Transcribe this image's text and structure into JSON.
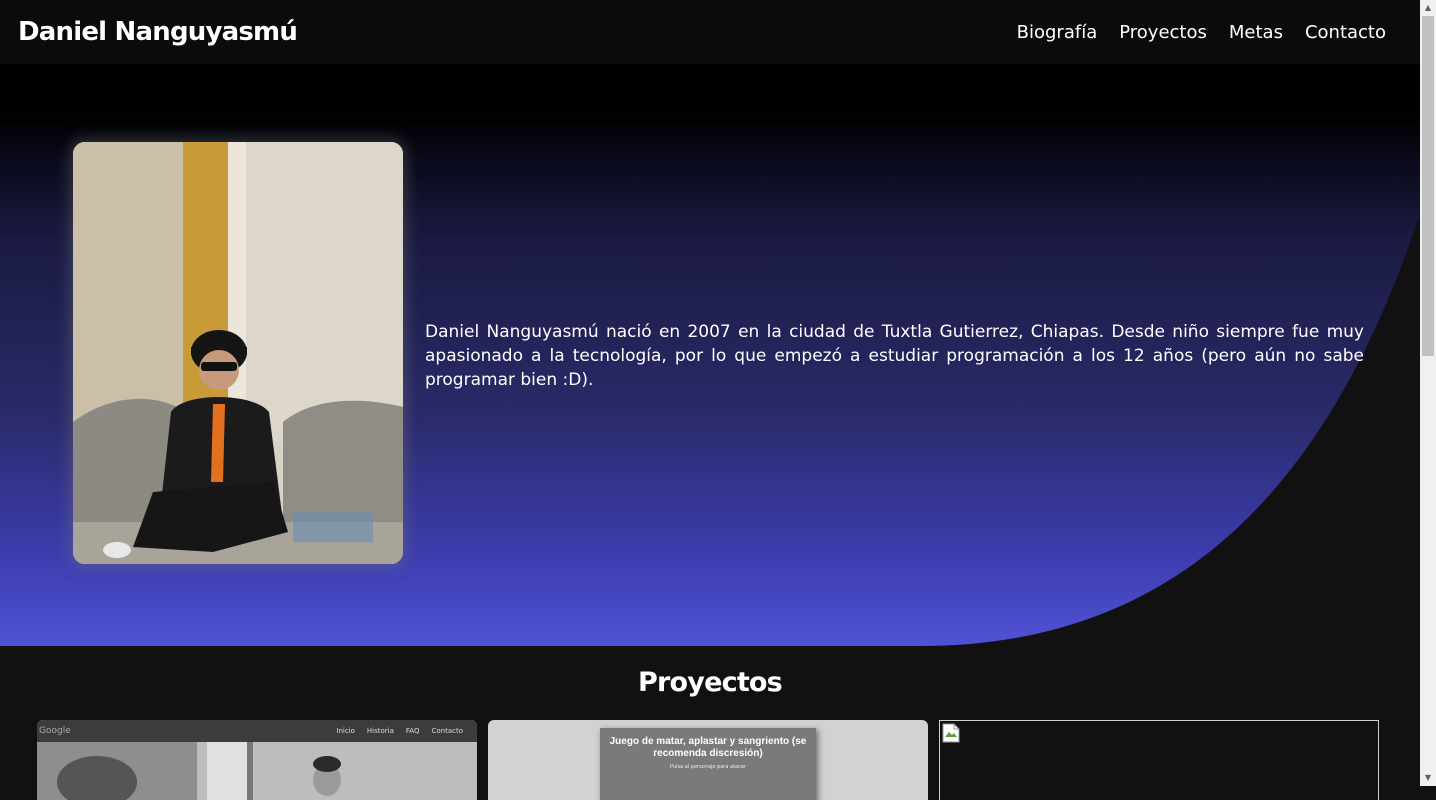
{
  "brand": "Daniel Nanguyasmú",
  "nav": [
    "Biografía",
    "Proyectos",
    "Metas",
    "Contacto"
  ],
  "bio": "Daniel Nanguyasmú nació en 2007 en la ciudad de Tuxtla Gutierrez, Chiapas. Desde niño siempre fue muy apasionado a la tecnología, por lo que empezó a estudiar programación a los 12 años (pero aún no sabe programar bien :D).",
  "projects_title": "Proyectos",
  "project_cards": {
    "card1": {
      "logo": "Google",
      "menu": [
        "Inicio",
        "Historia",
        "FAQ",
        "Contacto"
      ]
    },
    "card2": {
      "title": "Juego de matar, aplastar y sangriento (se recomenda discresión)",
      "subtitle": "Pulsa al personaje para atacar"
    }
  },
  "colors": {
    "hero_top": "#000000",
    "hero_bottom": "#5052d6",
    "page_bg": "#111111"
  }
}
